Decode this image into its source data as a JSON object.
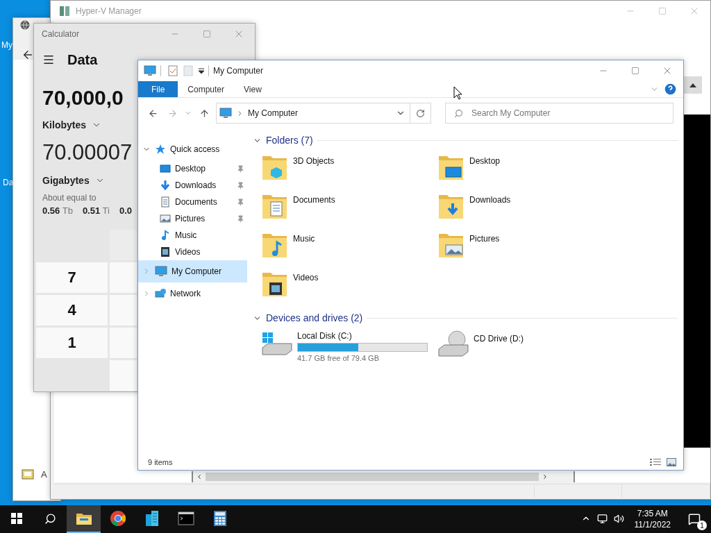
{
  "desktop": {
    "icon_labels": [
      "My",
      "Da"
    ]
  },
  "back_window": {
    "footer_text": "A"
  },
  "hyperv": {
    "title": "Hyper-V Manager"
  },
  "calculator": {
    "title": "Calculator",
    "mode": "Data",
    "input_value": "70,000,0",
    "input_unit": "Kilobytes",
    "output_value": "70.00007",
    "output_unit": "Gigabytes",
    "about_label": "About equal to",
    "equivalents": [
      {
        "value": "0.56",
        "unit": "Tb"
      },
      {
        "value": "0.51",
        "unit": "Ti"
      },
      {
        "value": "0.0"
      }
    ],
    "keys": [
      "7",
      "4",
      "1"
    ]
  },
  "explorer": {
    "title": "My Computer",
    "ribbon_tabs": [
      {
        "label": "File",
        "selected": true
      },
      {
        "label": "Computer",
        "selected": false
      },
      {
        "label": "View",
        "selected": false
      }
    ],
    "nav_buttons": {
      "back_enabled": true,
      "forward_enabled": false
    },
    "address": "My Computer",
    "search": {
      "placeholder": "Search My Computer"
    },
    "nav": [
      {
        "label": "Quick access",
        "expanded": true,
        "selected": false,
        "children": [
          {
            "label": "Desktop",
            "pinned": true,
            "selected": false
          },
          {
            "label": "Downloads",
            "pinned": true,
            "selected": false
          },
          {
            "label": "Documents",
            "pinned": true,
            "selected": false
          },
          {
            "label": "Pictures",
            "pinned": true,
            "selected": false
          },
          {
            "label": "Music",
            "pinned": false,
            "selected": false
          },
          {
            "label": "Videos",
            "pinned": false,
            "selected": false
          }
        ]
      },
      {
        "label": "My Computer",
        "expanded": false,
        "selected": true
      },
      {
        "label": "Network",
        "expanded": false,
        "selected": false
      }
    ],
    "folders": {
      "title": "Folders (7)",
      "expanded": true,
      "items": [
        "3D Objects",
        "Desktop",
        "Documents",
        "Downloads",
        "Music",
        "Pictures",
        "Videos"
      ]
    },
    "drives": {
      "title": "Devices and drives (2)",
      "expanded": true,
      "items": [
        {
          "kind": "disk",
          "name": "Local Disk (C:)",
          "level": 0.47,
          "info": "41.7 GB free of 79.4 GB"
        },
        {
          "kind": "cd",
          "name": "CD Drive (D:)"
        }
      ]
    },
    "status": "9 items"
  },
  "taskbar": {
    "apps": [
      {
        "selected": true
      },
      {
        "selected": false
      },
      {
        "selected": false
      },
      {
        "selected": false
      },
      {
        "selected": false
      }
    ],
    "time": "7:35 AM",
    "date": "11/1/2022",
    "notification_count": "1"
  }
}
